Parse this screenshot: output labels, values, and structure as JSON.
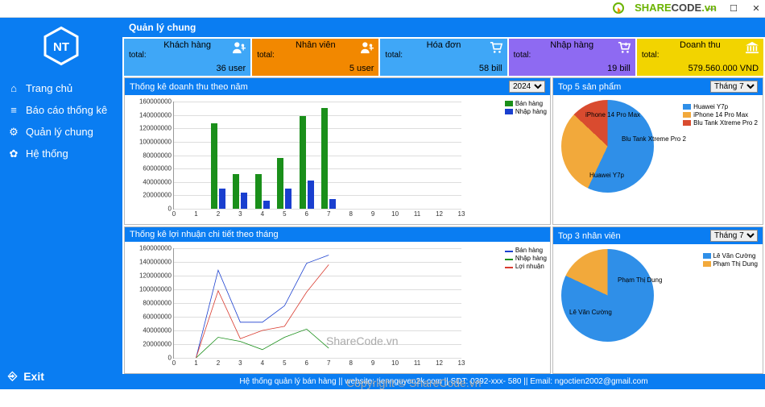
{
  "window_controls": {
    "min": "—",
    "max": "☐",
    "close": "✕"
  },
  "watermark": {
    "p1": "SHARE",
    "p2": "CODE",
    "p3": ".vn"
  },
  "sidebar": {
    "items": [
      {
        "icon": "⌂",
        "label": "Trang chủ"
      },
      {
        "icon": "≡",
        "label": "Báo cáo thống kê"
      },
      {
        "icon": "⚙",
        "label": "Quản lý chung"
      },
      {
        "icon": "✿",
        "label": "Hệ thống"
      }
    ],
    "exit": {
      "icon": "⎆",
      "label": "Exit"
    }
  },
  "page_title": "Quản lý chung",
  "stats": [
    {
      "title": "Khách hàng",
      "total_label": "total:",
      "value": "36 user"
    },
    {
      "title": "Nhân viên",
      "total_label": "total:",
      "value": "5 user"
    },
    {
      "title": "Hóa đơn",
      "total_label": "total:",
      "value": "58 bill"
    },
    {
      "title": "Nhập hàng",
      "total_label": "total:",
      "value": "19 bill"
    },
    {
      "title": "Doanh thu",
      "total_label": "total:",
      "value": "579.560.000 VND"
    }
  ],
  "panel1": {
    "title": "Thống kê doanh thu theo năm",
    "selector": "2024"
  },
  "panel2": {
    "title": "Top 5 sản phẩm",
    "selector": "Tháng 7"
  },
  "panel3": {
    "title": "Thống kê lợi nhuận chi tiết theo tháng"
  },
  "panel4": {
    "title": "Top 3 nhân viên",
    "selector": "Tháng 7"
  },
  "chart_data": [
    {
      "type": "bar",
      "title": "Thống kê doanh thu theo năm",
      "x": [
        1,
        2,
        3,
        4,
        5,
        6,
        7
      ],
      "xlim": [
        0,
        13
      ],
      "ylim": [
        0,
        160000000
      ],
      "yticks": [
        0,
        20000000,
        40000000,
        60000000,
        80000000,
        100000000,
        120000000,
        140000000,
        160000000
      ],
      "series": [
        {
          "name": "Bán hàng",
          "color": "#1a8f1a",
          "values": [
            0,
            128000000,
            52000000,
            52000000,
            76000000,
            138000000,
            150000000
          ]
        },
        {
          "name": "Nhập hàng",
          "color": "#1a3fcf",
          "values": [
            0,
            30000000,
            24000000,
            12000000,
            30000000,
            42000000,
            14000000
          ]
        }
      ]
    },
    {
      "type": "pie",
      "title": "Top 5 sản phẩm",
      "slices": [
        {
          "name": "Huawei Y7p",
          "value": 57,
          "color": "#2f8fe8"
        },
        {
          "name": "iPhone 14 Pro Max",
          "value": 30,
          "color": "#f2a93b"
        },
        {
          "name": "Blu Tank Xtreme Pro 2",
          "value": 13,
          "color": "#d94b2f"
        }
      ]
    },
    {
      "type": "line",
      "title": "Thống kê lợi nhuận chi tiết theo tháng",
      "x": [
        1,
        2,
        3,
        4,
        5,
        6,
        7
      ],
      "xlim": [
        0,
        13
      ],
      "ylim": [
        0,
        160000000
      ],
      "yticks": [
        0,
        20000000,
        40000000,
        60000000,
        80000000,
        100000000,
        120000000,
        140000000,
        160000000
      ],
      "series": [
        {
          "name": "Bán hàng",
          "color": "#1a3fcf",
          "values": [
            0,
            128000000,
            52000000,
            52000000,
            76000000,
            138000000,
            150000000
          ]
        },
        {
          "name": "Nhập hàng",
          "color": "#1a8f1a",
          "values": [
            0,
            30000000,
            24000000,
            12000000,
            30000000,
            42000000,
            14000000
          ]
        },
        {
          "name": "Lợi nhuận",
          "color": "#d93b2f",
          "values": [
            0,
            98000000,
            28000000,
            40000000,
            46000000,
            96000000,
            136000000
          ]
        }
      ]
    },
    {
      "type": "pie",
      "title": "Top 3 nhân viên",
      "slices": [
        {
          "name": "Lê Văn Cường",
          "value": 82,
          "color": "#2f8fe8"
        },
        {
          "name": "Phạm Thị Dung",
          "value": 18,
          "color": "#f2a93b"
        }
      ]
    }
  ],
  "footer": "Hệ thống quản lý bán hàng || website: tiennguyen2k.com || SDT: 0392-xxx- 580 || Email: ngoctien2002@gmail.com",
  "overlay1": "ShareCode.vn",
  "overlay2": "Copyright © ShareCode.vn"
}
